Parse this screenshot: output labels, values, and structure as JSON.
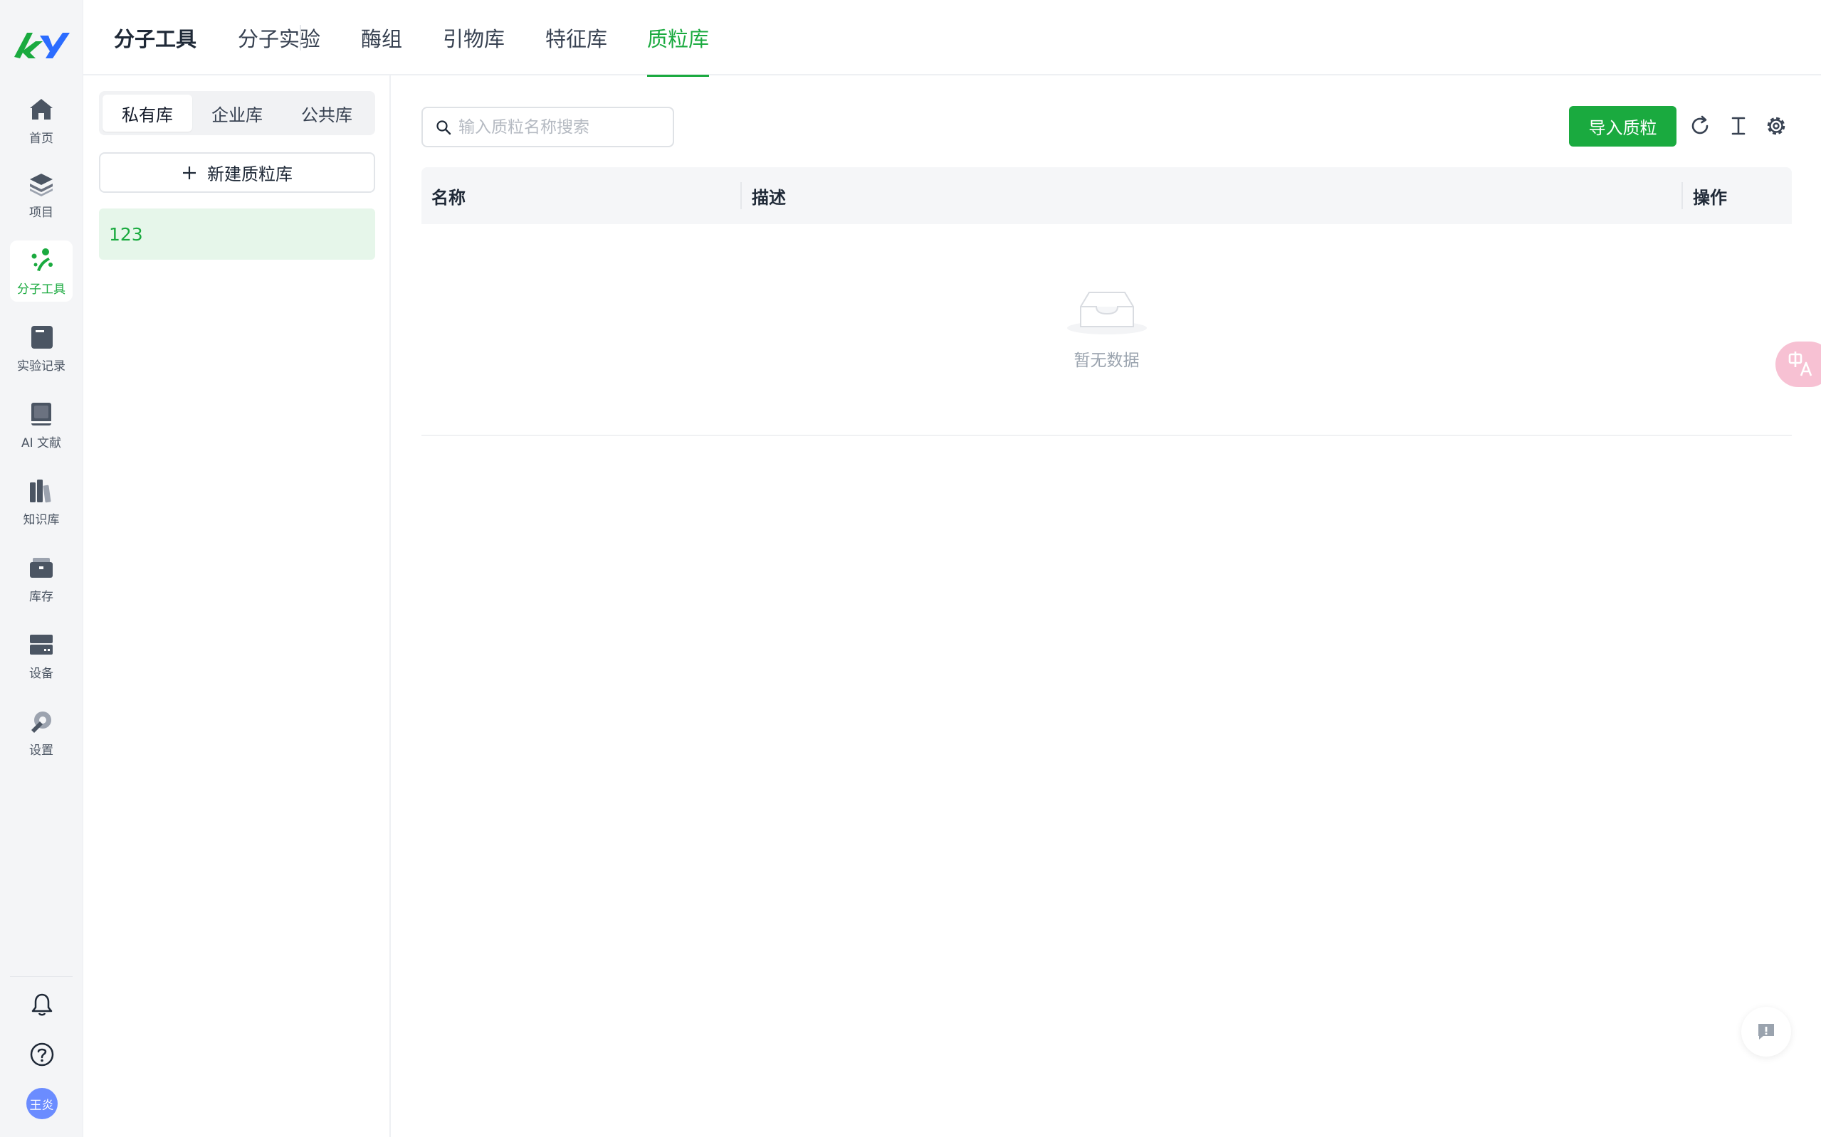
{
  "sidebar": {
    "items": [
      {
        "label": "首页",
        "icon": "home-icon"
      },
      {
        "label": "项目",
        "icon": "layers-icon"
      },
      {
        "label": "分子工具",
        "icon": "molecule-icon",
        "active": true
      },
      {
        "label": "实验记录",
        "icon": "notebook-icon"
      },
      {
        "label": "AI 文献",
        "icon": "book-icon"
      },
      {
        "label": "知识库",
        "icon": "library-icon"
      },
      {
        "label": "库存",
        "icon": "inventory-icon"
      },
      {
        "label": "设备",
        "icon": "device-icon"
      },
      {
        "label": "设置",
        "icon": "settings-wrench-icon"
      }
    ],
    "user_avatar": "王炎"
  },
  "topnav": {
    "tabs": [
      "分子工具",
      "分子实验",
      "酶组",
      "引物库",
      "特征库",
      "质粒库"
    ],
    "active_index": 5
  },
  "library_panel": {
    "scopes": [
      "私有库",
      "企业库",
      "公共库"
    ],
    "active_scope": 0,
    "new_button": "新建质粒库",
    "libraries": [
      "123"
    ]
  },
  "toolbar": {
    "search_placeholder": "输入质粒名称搜索",
    "import_button": "导入质粒"
  },
  "table": {
    "columns": [
      "名称",
      "描述",
      "操作"
    ],
    "empty_text": "暂无数据"
  },
  "colors": {
    "accent": "#1aaa3f",
    "accent_light": "#e6f6ea",
    "rail_bg": "#f4f5f7",
    "header_bg": "#f5f6f8"
  }
}
